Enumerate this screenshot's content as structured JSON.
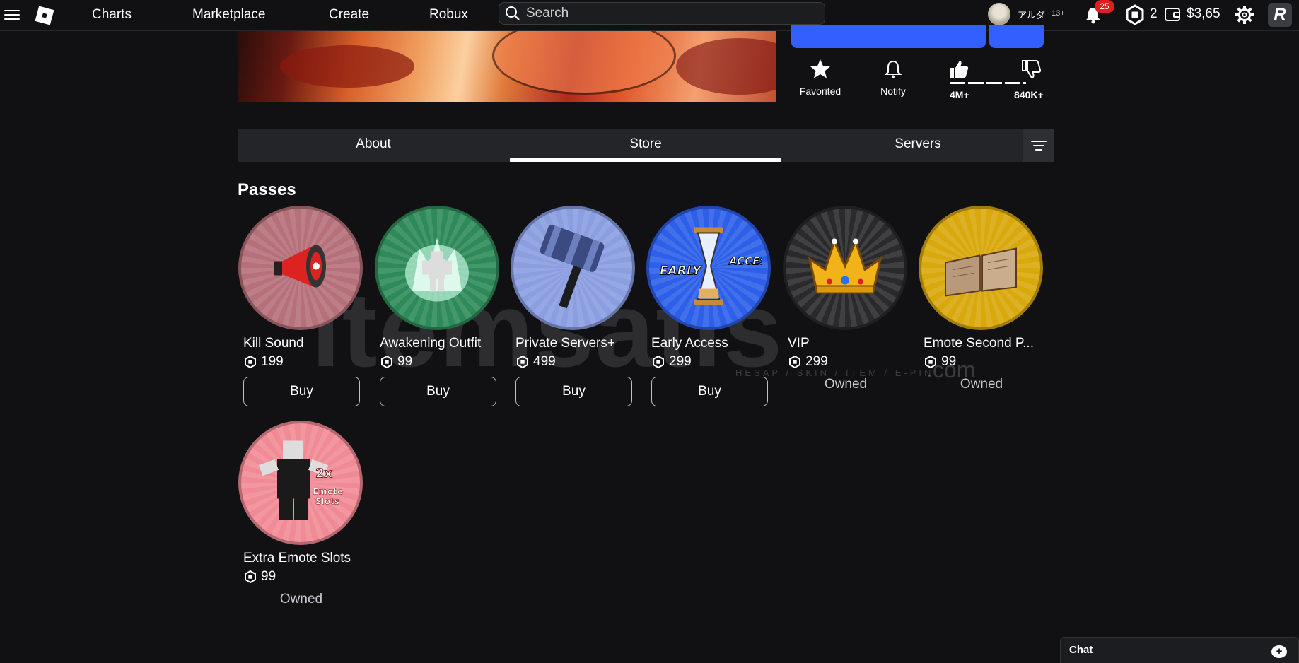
{
  "nav": {
    "links": [
      "Charts",
      "Marketplace",
      "Create",
      "Robux"
    ],
    "search_placeholder": "Search",
    "username": "アルダ",
    "age_badge": "13+",
    "notification_count": "25",
    "robux_count": "2",
    "balance": "$3,65"
  },
  "game": {
    "actions": {
      "favorited": "Favorited",
      "notify": "Notify"
    },
    "votes": {
      "up": "4M+",
      "down": "840K+"
    }
  },
  "tabs": [
    "About",
    "Store",
    "Servers"
  ],
  "active_tab": "Store",
  "passes_title": "Passes",
  "passes": [
    {
      "name": "Kill Sound",
      "price": "199",
      "status": "Buy",
      "color": "#b5707a"
    },
    {
      "name": "Awakening Outfit",
      "price": "99",
      "status": "Buy",
      "color": "#2f8a5a"
    },
    {
      "name": "Private Servers+",
      "price": "499",
      "status": "Buy",
      "color": "#8a9ee0"
    },
    {
      "name": "Early Access",
      "price": "299",
      "status": "Buy",
      "color": "#2d5fe8"
    },
    {
      "name": "VIP",
      "price": "299",
      "status": "Owned",
      "color": "#2a2a2d"
    },
    {
      "name": "Emote Second P...",
      "price": "99",
      "status": "Owned",
      "color": "#d9a80c"
    },
    {
      "name": "Extra Emote Slots",
      "price": "99",
      "status": "Owned",
      "color": "#f08a94"
    }
  ],
  "early_access_text": [
    "EARLY",
    "ACCESS"
  ],
  "extra_emote_text": "2x Emote Slots",
  "watermark": "itemsatis",
  "watermark_sub": "HESAP / SKIN / ITEM / E-PIN",
  "watermark_com": ".com",
  "chat_label": "Chat"
}
